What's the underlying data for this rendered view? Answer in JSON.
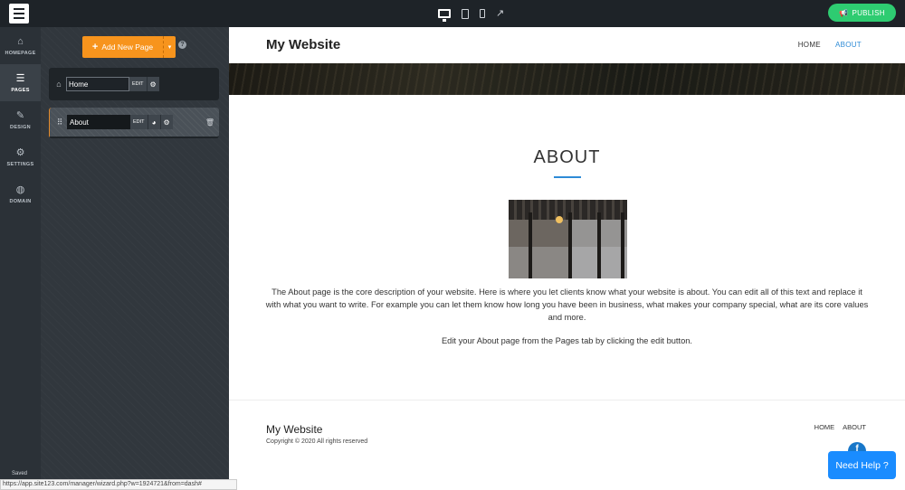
{
  "topbar": {
    "publish_label": "PUBLISH",
    "device_icons": [
      "desktop-icon",
      "tablet-icon",
      "phone-icon",
      "external-link-icon"
    ]
  },
  "leftnav": {
    "items": [
      {
        "label": "HOMEPAGE",
        "icon": "home-icon"
      },
      {
        "label": "PAGES",
        "icon": "pages-icon",
        "active": true
      },
      {
        "label": "DESIGN",
        "icon": "brush-icon"
      },
      {
        "label": "SETTINGS",
        "icon": "gear-icon"
      },
      {
        "label": "DOMAIN",
        "icon": "globe-icon"
      }
    ],
    "saved": "Saved"
  },
  "panel": {
    "add_page_label": "Add New Page",
    "help": "?",
    "pages": [
      {
        "name": "Home",
        "edit": "EDIT"
      },
      {
        "name": "About",
        "edit": "EDIT"
      }
    ]
  },
  "site": {
    "title": "My Website",
    "nav": [
      "HOME",
      "ABOUT"
    ],
    "about_title": "ABOUT",
    "about_text": "The About page is the core description of your website. Here is where you let clients know what your website is about. You can edit all of this text and replace it with what you want to write. For example you can let them know how long you have been in business, what makes your company special, what are its core values and more.",
    "about_text2": "Edit your About page from the Pages tab by clicking the edit button.",
    "footer_title": "My Website",
    "footer_copy": "Copyright © 2020 All rights reserved",
    "footer_nav": [
      "HOME",
      "ABOUT"
    ],
    "facebook": "f"
  },
  "need_help": "Need Help ?",
  "status_url": "https://app.site123.com/manager/wizard.php?w=1924721&from=dash#",
  "colors": {
    "accent_orange": "#f7941d",
    "publish_green": "#2ecc71",
    "link_blue": "#2e8bd6",
    "help_blue": "#1a8cff"
  }
}
